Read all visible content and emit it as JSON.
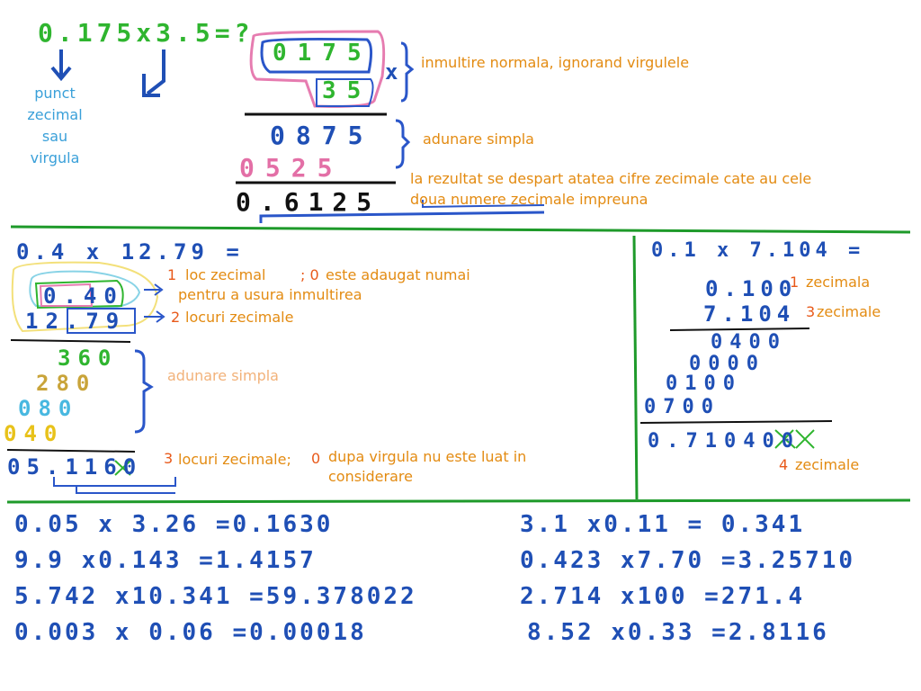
{
  "top": {
    "problem": "0.175x3.5=?",
    "side_label": [
      "punct",
      "zecimal",
      "sau",
      "virgula"
    ],
    "row_a": "0175",
    "row_b": "35",
    "times": "x",
    "partial1": "0875",
    "partial2": "0525",
    "result": "0.6125",
    "note1": "inmultire normala, ignorand virgulele",
    "note2": "adunare simpla",
    "note3": [
      "la rezultat se despart atatea cifre zecimale cate au cele",
      "doua numere zecimale impreuna"
    ]
  },
  "left": {
    "problem": "0.4 x 12.79 =",
    "row_a": "0.40",
    "row_b": "12.79",
    "n1": "1",
    "note1": "loc zecimal",
    "note1b": "pentru a usura inmultirea",
    "n0": "; 0",
    "note0": "este adaugat numai",
    "n2": "2",
    "note2": "locuri zecimale",
    "lines": [
      "360",
      "280",
      "080",
      "040"
    ],
    "note_add": "adunare simpla",
    "result": "05.1160",
    "n3": "3",
    "note3": "locuri zecimale;",
    "n0b": "0",
    "note3b": [
      "dupa virgula nu este luat in",
      "considerare"
    ]
  },
  "right": {
    "problem": "0.1 x 7.104 =",
    "row_a": "0.100",
    "row_b": "7.104",
    "n1": "1",
    "note1": "zecimala",
    "n3": "3",
    "note3": "zecimale",
    "lines": [
      "0400",
      "0000",
      "0100",
      "0700"
    ],
    "result": "0.710400",
    "n4": "4",
    "note4": "zecimale"
  },
  "bottom": {
    "left": [
      "0.05 x 3.26 =0.1630",
      "9.9 x0.143 =1.4157",
      "5.742 x10.341 =59.378022",
      "0.003 x 0.06 =0.00018"
    ],
    "right": [
      "3.1 x0.11 = 0.341",
      "0.423 x7.70 =3.25710",
      "2.714 x100 =271.4",
      "8.52 x0.33 =2.8116"
    ]
  }
}
